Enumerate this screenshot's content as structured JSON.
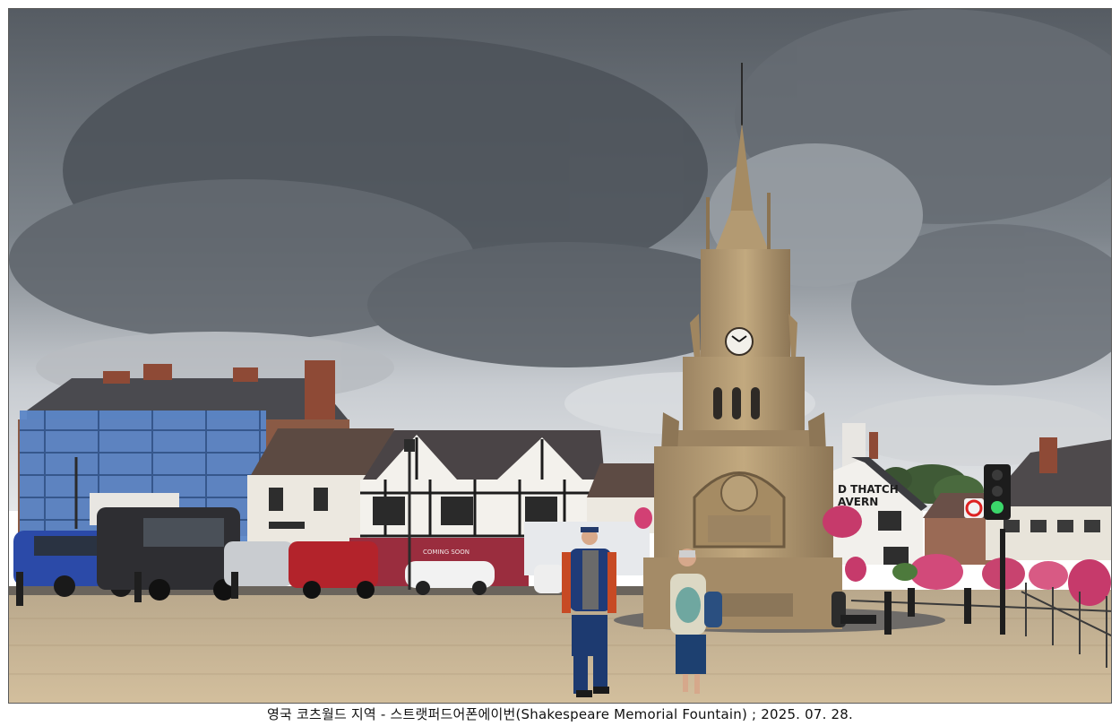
{
  "caption": "영국 코츠월드 지역 - 스트랫퍼드어폰에이번(Shakespeare Memorial Fountain) ; 2025. 07. 28.",
  "scene": {
    "pub_sign": "THE OLD THATCH TAVERN",
    "pub_sign_lines": [
      "D THATCH",
      "AVERN"
    ],
    "shop_sign": "COMING SOON",
    "clock_time_visible": "10:10"
  },
  "colors": {
    "sky_top": "#5f656c",
    "sky_bottom": "#d9dcdf",
    "stone": "#b39a74",
    "pavement": "#c9b493",
    "scaffold_blue": "#5b86c7",
    "traffic_light_green": "#3bd66a"
  }
}
